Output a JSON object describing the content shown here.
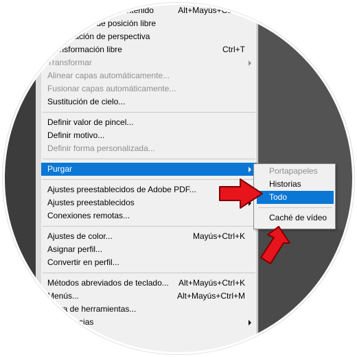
{
  "menu": {
    "items": [
      {
        "label": "Transformación de contenido",
        "shortcut": "Alt+Mayús+Ctrl+C",
        "disabled": false
      },
      {
        "label": "Deformación de posición libre",
        "shortcut": "",
        "disabled": false
      },
      {
        "label": "Deformación de perspectiva",
        "shortcut": "",
        "disabled": false
      },
      {
        "label": "Transformación libre",
        "shortcut": "Ctrl+T",
        "disabled": false
      },
      {
        "label": "Transformar",
        "shortcut": "",
        "disabled": false,
        "submenu": true
      },
      {
        "label": "Alinear capas automáticamente...",
        "shortcut": "",
        "disabled": true
      },
      {
        "label": "Fusionar capas automáticamente...",
        "shortcut": "",
        "disabled": true
      },
      {
        "label": "Sustitución de cielo...",
        "shortcut": "",
        "disabled": false
      },
      {
        "label": "Definir valor de pincel...",
        "shortcut": "",
        "disabled": false
      },
      {
        "label": "Definir motivo...",
        "shortcut": "",
        "disabled": false
      },
      {
        "label": "Definir forma personalizada...",
        "shortcut": "",
        "disabled": true
      },
      {
        "label": "Purgar",
        "shortcut": "",
        "disabled": false,
        "submenu": true,
        "highlighted": true
      },
      {
        "label": "Ajustes preestablecidos de Adobe PDF...",
        "shortcut": "",
        "disabled": false
      },
      {
        "label": "Ajustes preestablecidos",
        "shortcut": "",
        "disabled": false,
        "submenu": true
      },
      {
        "label": "Conexiones remotas...",
        "shortcut": "",
        "disabled": false
      },
      {
        "label": "Ajustes de color...",
        "shortcut": "Mayús+Ctrl+K",
        "disabled": false
      },
      {
        "label": "Asignar perfil...",
        "shortcut": "",
        "disabled": false
      },
      {
        "label": "Convertir en perfil...",
        "shortcut": "",
        "disabled": false
      },
      {
        "label": "Métodos abreviados de teclado...",
        "shortcut": "Alt+Mayús+Ctrl+K",
        "disabled": false
      },
      {
        "label": "Menús...",
        "shortcut": "Alt+Mayús+Ctrl+M",
        "disabled": false
      },
      {
        "label": "Barra de herramientas...",
        "shortcut": "",
        "disabled": false
      },
      {
        "label": "Preferencias",
        "shortcut": "",
        "disabled": false,
        "submenu": true
      }
    ]
  },
  "submenu": {
    "items": [
      {
        "label": "Portapapeles",
        "disabled": true
      },
      {
        "label": "Historias",
        "disabled": false
      },
      {
        "label": "Todo",
        "disabled": false,
        "highlighted": true
      },
      {
        "label": "Caché de vídeo",
        "disabled": false
      }
    ]
  },
  "colors": {
    "highlight": "#0a77d5",
    "arrow": "#e8141c",
    "menu_bg": "#f0f0f0",
    "disabled_text": "#8e8e8e"
  }
}
